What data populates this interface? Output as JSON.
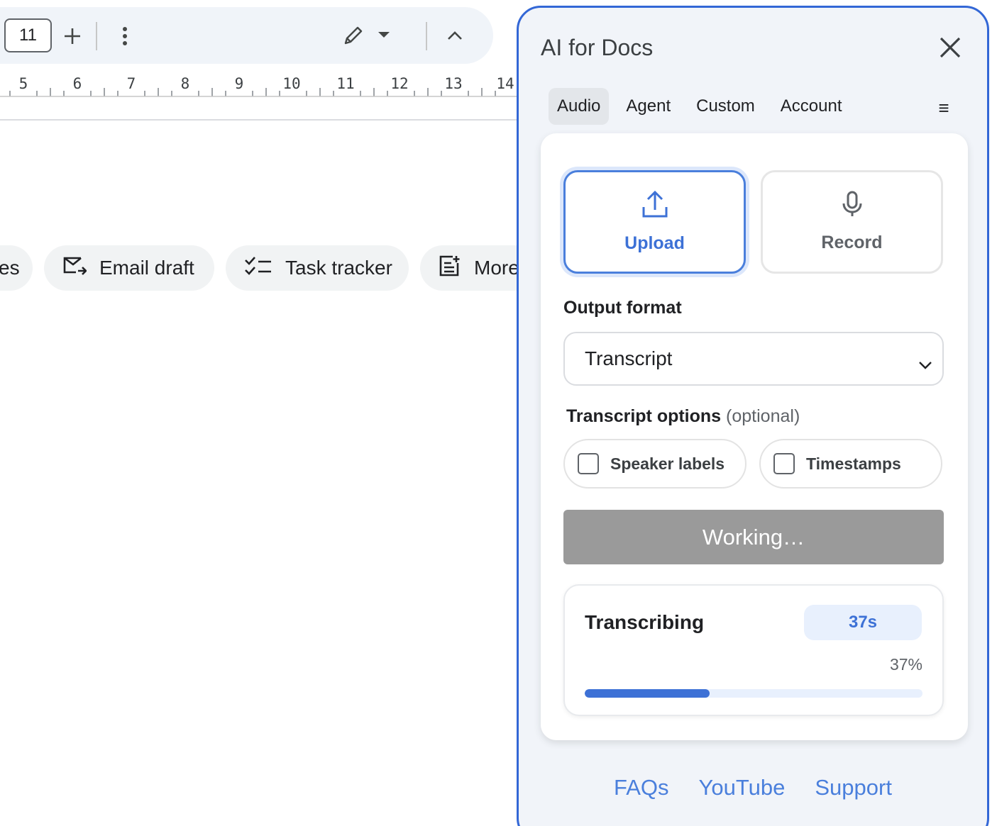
{
  "toolbar": {
    "font_size": "11",
    "icons": [
      "plus-icon",
      "more-vert-icon",
      "pencil-icon",
      "caret-down-icon",
      "chevron-up-icon"
    ]
  },
  "ruler": {
    "numbers": [
      "5",
      "6",
      "7",
      "8",
      "9",
      "10",
      "11",
      "12",
      "13",
      "14"
    ]
  },
  "chips": [
    {
      "label": "es",
      "icon": ""
    },
    {
      "label": "Email draft",
      "icon": "email-draft-icon"
    },
    {
      "label": "Task tracker",
      "icon": "task-list-icon"
    },
    {
      "label": "More",
      "icon": "note-add-icon"
    }
  ],
  "panel": {
    "title": "AI for Docs",
    "tabs": [
      {
        "label": "Audio",
        "active": true
      },
      {
        "label": "Agent",
        "active": false
      },
      {
        "label": "Custom",
        "active": false
      },
      {
        "label": "Account",
        "active": false
      }
    ],
    "menu_glyph": "≡",
    "sources": {
      "upload_label": "Upload",
      "record_label": "Record"
    },
    "output_format": {
      "label": "Output format",
      "selected": "Transcript"
    },
    "transcript_options": {
      "label": "Transcript options",
      "optional": "(optional)",
      "speaker_labels": {
        "label": "Speaker labels",
        "checked": false
      },
      "timestamps": {
        "label": "Timestamps",
        "checked": false
      }
    },
    "action_button": "Working…",
    "progress": {
      "title": "Transcribing",
      "elapsed": "37s",
      "percent_text": "37%",
      "percent": 37
    },
    "footer_links": [
      "FAQs",
      "YouTube",
      "Support"
    ]
  },
  "colors": {
    "accent": "#3d71d6",
    "panel_border": "#3367d6",
    "panel_bg": "#f1f4f9",
    "disabled_button": "#9a9a9a",
    "progress_track": "#e8f0fd"
  }
}
